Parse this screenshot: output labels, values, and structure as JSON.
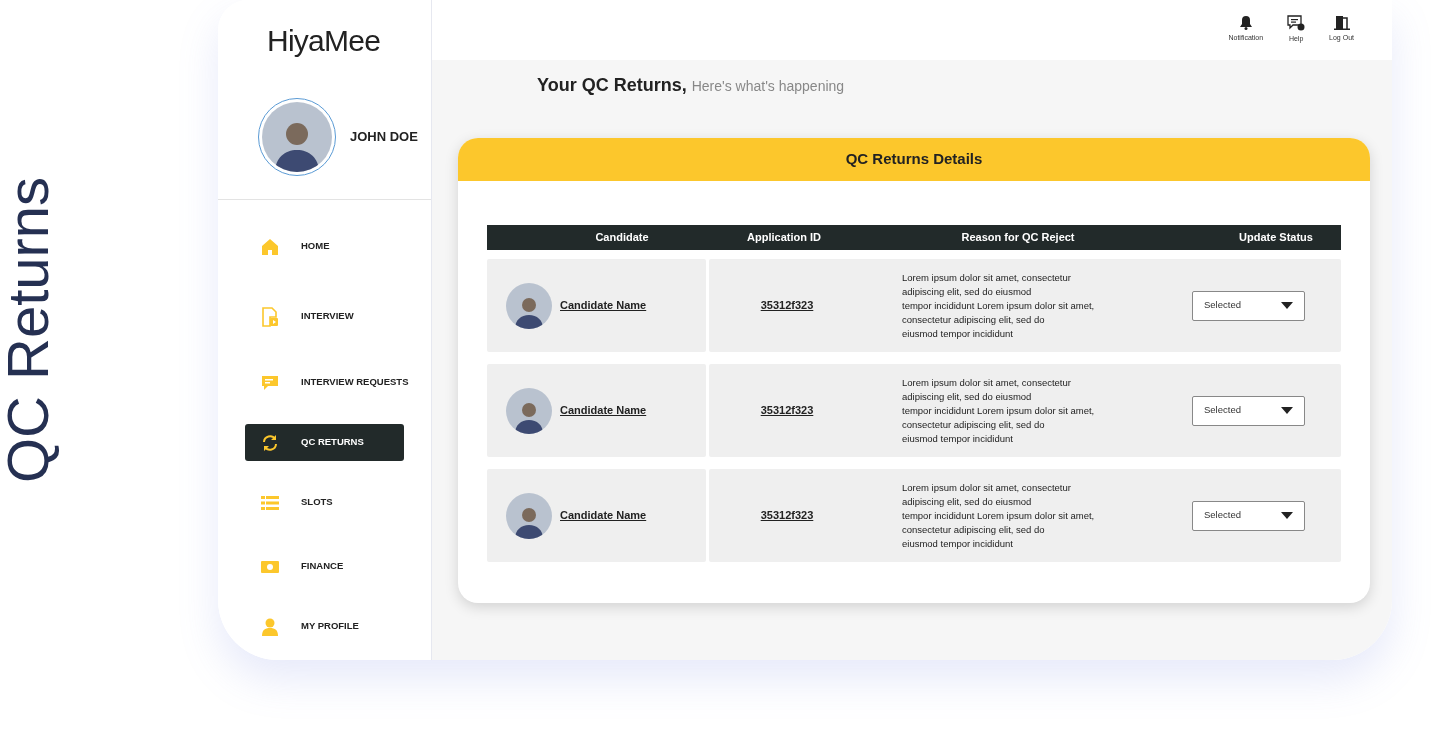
{
  "side_title": "QC Returns",
  "logo": "HiyaMee",
  "user": {
    "name": "JOHN DOE"
  },
  "nav": [
    {
      "label": "HOME",
      "selected": false
    },
    {
      "label": "INTERVIEW",
      "selected": false
    },
    {
      "label": "INTERVIEW REQUESTS",
      "selected": false
    },
    {
      "label": "QC RETURNS",
      "selected": true
    },
    {
      "label": "SLOTS",
      "selected": false
    },
    {
      "label": "FINANCE",
      "selected": false
    },
    {
      "label": "MY PROFILE",
      "selected": false
    }
  ],
  "header_actions": [
    {
      "label": "Notification"
    },
    {
      "label": "Help"
    },
    {
      "label": "Log Out"
    }
  ],
  "page_title": {
    "title": "Your QC Returns,",
    "subtitle": "Here's what's happening"
  },
  "card": {
    "title": "QC Returns Details"
  },
  "table": {
    "columns": [
      "Candidate",
      "Application ID",
      "Reason for QC Reject",
      "Update Status"
    ],
    "rows": [
      {
        "candidate": "Candidate Name",
        "application_id": "35312f323",
        "reason": "Lorem ipsum dolor sit amet, consectetur\nadipiscing elit, sed do eiusmod\ntempor incididunt Lorem ipsum dolor sit amet,\nconsectetur adipiscing elit, sed do\neiusmod tempor incididunt",
        "status": "Selected"
      },
      {
        "candidate": "Candidate Name",
        "application_id": "35312f323",
        "reason": "Lorem ipsum dolor sit amet, consectetur\nadipiscing elit, sed do eiusmod\ntempor incididunt Lorem ipsum dolor sit amet,\nconsectetur adipiscing elit, sed do\neiusmod tempor incididunt",
        "status": "Selected"
      },
      {
        "candidate": "Candidate Name",
        "application_id": "35312f323",
        "reason": "Lorem ipsum dolor sit amet, consectetur\nadipiscing elit, sed do eiusmod\ntempor incididunt Lorem ipsum dolor sit amet,\nconsectetur adipiscing elit, sed do\neiusmod tempor incididunt",
        "status": "Selected"
      }
    ]
  }
}
